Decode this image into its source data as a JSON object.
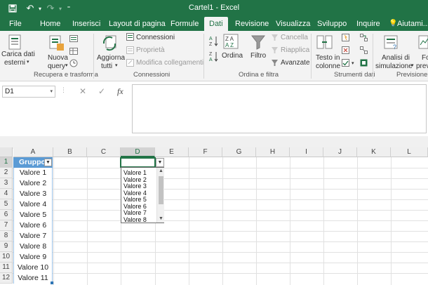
{
  "window": {
    "title": "Cartel1 - Excel"
  },
  "quick_access": {
    "save_icon": "save-icon",
    "undo_icon": "undo-icon",
    "redo_icon": "redo-icon"
  },
  "tabs": [
    {
      "label": "File"
    },
    {
      "label": "Home"
    },
    {
      "label": "Inserisci"
    },
    {
      "label": "Layout di pagina"
    },
    {
      "label": "Formule"
    },
    {
      "label": "Dati"
    },
    {
      "label": "Revisione"
    },
    {
      "label": "Visualizza"
    },
    {
      "label": "Sviluppo"
    },
    {
      "label": "Inquire"
    },
    {
      "label": "Aiutami..."
    }
  ],
  "ribbon": {
    "carica_dati_line1": "Carica dati",
    "carica_dati_line2": "esterni",
    "nuova_query_line1": "Nuova",
    "nuova_query_line2": "query",
    "aggiorna_line1": "Aggiorna",
    "aggiorna_line2": "tutti",
    "connessioni": "Connessioni",
    "proprieta": "Proprietà",
    "modifica_collegamenti": "Modifica collegamenti",
    "ordina": "Ordina",
    "filtro": "Filtro",
    "cancella": "Cancella",
    "riapplica": "Riapplica",
    "avanzate": "Avanzate",
    "testo_line1": "Testo in",
    "testo_line2": "colonne",
    "analisi_line1": "Analisi di",
    "analisi_line2": "simulazione",
    "previsione_line1": "Fo",
    "previsione_line2": "prev",
    "groups": {
      "recupera": "Recupera e trasforma",
      "connessioni": "Connessioni",
      "ordina": "Ordina e filtra",
      "strumenti": "Strumenti dati",
      "previsione": "Previsione"
    }
  },
  "formula_bar": {
    "name_box": "D1",
    "cancel": "✕",
    "enter": "✓",
    "fx": "fx"
  },
  "sheet": {
    "columns": [
      "A",
      "B",
      "C",
      "D",
      "E",
      "F",
      "G",
      "H",
      "I",
      "J",
      "K",
      "L"
    ],
    "rows": [
      "1",
      "2",
      "3",
      "4",
      "5",
      "6",
      "7",
      "8",
      "9",
      "10",
      "11",
      "12"
    ],
    "a_header": "Gruppo",
    "a_values": [
      "Valore 1",
      "Valore 2",
      "Valore 3",
      "Valore 4",
      "Valore 5",
      "Valore 6",
      "Valore 7",
      "Valore 8",
      "Valore 9",
      "Valore 10",
      "Valore 11"
    ],
    "dropdown_items": [
      "Valore 1",
      "Valore 2",
      "Valore 3",
      "Valore 4",
      "Valore 5",
      "Valore 6",
      "Valore 7",
      "Valore 8"
    ]
  },
  "colors": {
    "accent": "#217346",
    "table_header": "#5b9bd5"
  }
}
